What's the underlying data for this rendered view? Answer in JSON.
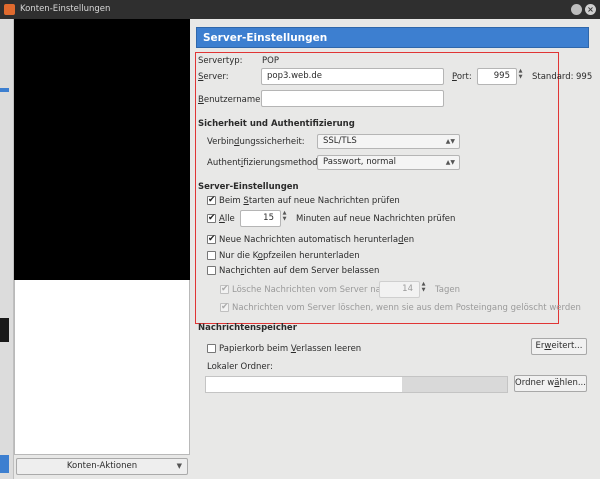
{
  "window": {
    "title": "Konten-Einstellungen"
  },
  "left": {
    "account_actions_label": "Konten-Aktionen"
  },
  "header": {
    "title": "Server-Einstellungen"
  },
  "server": {
    "type_label": "Servertyp:",
    "type_value": "POP",
    "server_label_pre": "",
    "server_label_key": "S",
    "server_label_post": "erver:",
    "server_value": "pop3.web.de",
    "port_label_key": "P",
    "port_label_post": "ort:",
    "port_value": "995",
    "standard_label": "Standard:",
    "standard_value": "995",
    "username_label_key": "B",
    "username_label_post": "enutzername:",
    "username_value": ""
  },
  "security": {
    "section_title": "Sicherheit und Authentifizierung",
    "connection_label_pre": "Verbin",
    "connection_label_key": "d",
    "connection_label_post": "ungssicherheit:",
    "connection_value": "SSL/TLS",
    "auth_label_pre": "Authent",
    "auth_label_key": "i",
    "auth_label_post": "fizierungsmethode:",
    "auth_value": "Passwort, normal"
  },
  "settings": {
    "section_title": "Server-Einstellungen",
    "check_on_start_pre": "Beim ",
    "check_on_start_key": "S",
    "check_on_start_post": "tarten auf neue Nachrichten prüfen",
    "check_every_key": "A",
    "check_every_post": "lle",
    "check_every_value": "15",
    "check_every_suffix": "Minuten auf neue Nachrichten prüfen",
    "auto_download_pre": "Neue Nachrichten automatisch herunterla",
    "auto_download_key": "d",
    "auto_download_post": "en",
    "headers_only_pre": "Nur die K",
    "headers_only_key": "o",
    "headers_only_post": "pfzeilen herunterladen",
    "leave_on_server_pre": "Nach",
    "leave_on_server_key": "r",
    "leave_on_server_post": "ichten auf dem Server belassen",
    "delete_after_pre": "Lösche Nachrichten vom Server nach",
    "delete_after_value": "14",
    "delete_after_suffix": "Tagen",
    "delete_when_removed": "Nachrichten vom Server löschen, wenn sie aus dem Posteingang gelöscht werden"
  },
  "storage": {
    "section_title": "Nachrichtenspeicher",
    "empty_trash_pre": "Papierkorb beim ",
    "empty_trash_key": "V",
    "empty_trash_post": "erlassen leeren",
    "advanced_pre": "Er",
    "advanced_key": "w",
    "advanced_post": "eitert...",
    "local_folder_label": "Lokaler Ordner:",
    "local_folder_value": "",
    "choose_folder_pre": "Ordner w",
    "choose_folder_key": "ä",
    "choose_folder_post": "hlen..."
  }
}
